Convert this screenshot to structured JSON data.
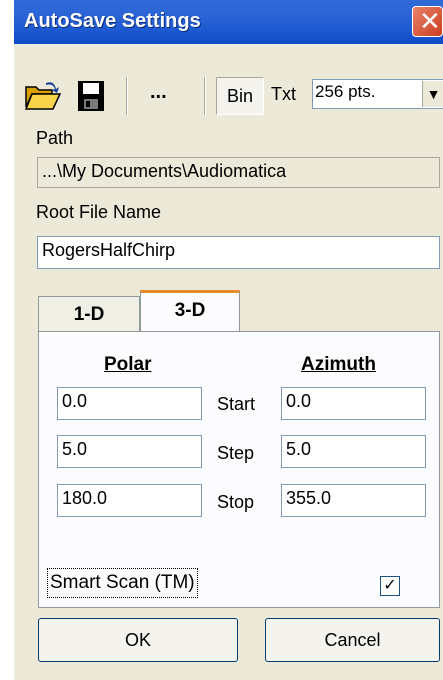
{
  "window": {
    "title": "AutoSave Settings",
    "close_glyph": "✕"
  },
  "toolbar": {
    "open_icon": "open-folder-icon",
    "save_icon": "floppy-save-icon",
    "more_label": "...",
    "bin_label": "Bin",
    "txt_label": "Txt",
    "points_value": "256 pts.",
    "dropdown_arrow": "▼"
  },
  "path": {
    "label": "Path",
    "value": "...\\My Documents\\Audiomatica"
  },
  "root_file": {
    "label": "Root File Name",
    "value": "RogersHalfChirp"
  },
  "tabs": [
    {
      "label": "1-D",
      "active": false
    },
    {
      "label": "3-D",
      "active": true
    }
  ],
  "panel": {
    "polar_header": "Polar",
    "azimuth_header": "Azimuth",
    "rows": [
      {
        "label": "Start",
        "polar": "0.0",
        "azimuth": "0.0"
      },
      {
        "label": "Step",
        "polar": "5.0",
        "azimuth": "5.0"
      },
      {
        "label": "Stop",
        "polar": "180.0",
        "azimuth": "355.0"
      }
    ],
    "smart_scan_label": "Smart Scan (TM)",
    "smart_scan_checked": true,
    "check_glyph": "✓"
  },
  "buttons": {
    "ok": "OK",
    "cancel": "Cancel"
  }
}
